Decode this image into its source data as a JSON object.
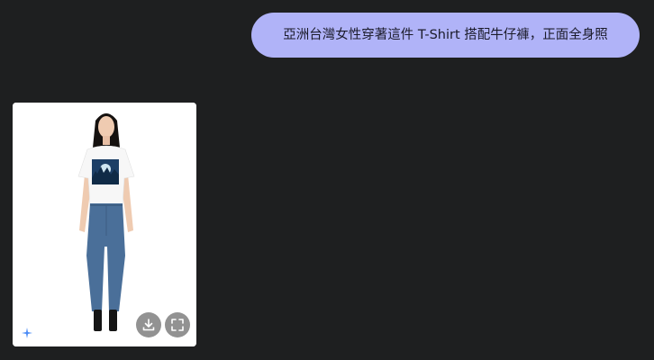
{
  "chat": {
    "user_message": "亞洲台灣女性穿著這件 T-Shirt 搭配牛仔褲，正面全身照"
  },
  "generated_image": {
    "badge_icon": "sparkle-icon",
    "actions": [
      {
        "icon": "download-icon"
      },
      {
        "icon": "fullscreen-icon"
      }
    ]
  },
  "colors": {
    "background": "#1e1f20",
    "user_bubble": "#b0b3f8",
    "user_text": "#1b1b2a",
    "sparkle": "#4b8bf5"
  }
}
